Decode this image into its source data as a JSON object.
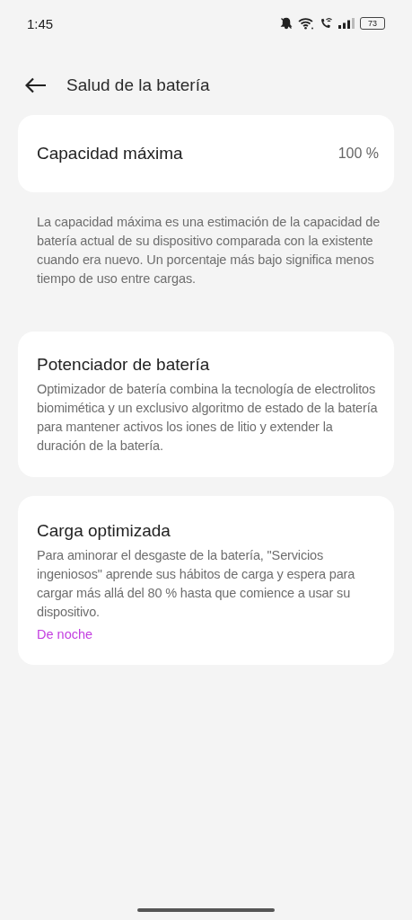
{
  "status_bar": {
    "time": "1:45",
    "battery": "73"
  },
  "header": {
    "title": "Salud de la batería"
  },
  "capacity": {
    "label": "Capacidad máxima",
    "value": "100 %"
  },
  "capacity_note": "La capacidad máxima es una estimación de la capacidad de batería actual de su dispositivo comparada con la existente cuando era nuevo. Un porcentaje más bajo significa menos tiempo de uso entre cargas.",
  "cards": [
    {
      "title": "Potenciador de batería",
      "description": "Optimizador de batería combina la tecnología de electrolitos biomimética y un exclusivo algoritmo de estado de la batería para mantener activos los iones de litio y extender la duración de la batería."
    },
    {
      "title": "Carga optimizada",
      "description": "Para aminorar el desgaste de la batería, \"Servicios ingeniosos\" aprende sus hábitos de carga y espera para cargar más allá del 80 % hasta que comience a usar su dispositivo.",
      "link": "De noche"
    }
  ]
}
